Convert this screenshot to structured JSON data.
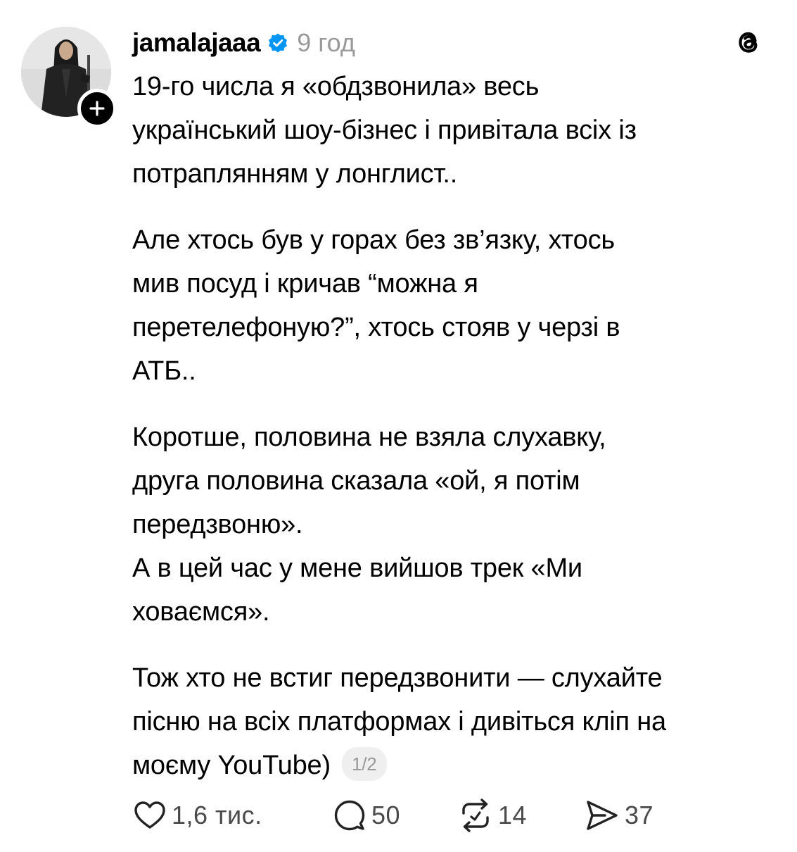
{
  "post": {
    "author": {
      "username": "jamalajaaa",
      "verified": true,
      "avatar_icon": "profile-photo",
      "follow_icon": "plus-icon"
    },
    "time_ago": "9 год",
    "app_icon": "threads-logo-icon",
    "paragraphs": [
      {
        "lines": [
          "19-го числа я «обдзвонила» весь",
          "український шоу-бізнес і привітала всіх із",
          "потраплянням у лонглист.."
        ]
      },
      {
        "lines": [
          "Але хтось був у горах без зв’язку, хтось",
          "мив посуд і кричав “можна я",
          "перетелефоную?”, хтось стояв у черзі в",
          "АТБ.."
        ]
      },
      {
        "lines": [
          "Коротше, половина не взяла слухавку,",
          "друга половина сказала «ой, я потім",
          "передзвоню».",
          "А в цей час у мене вийшов трек «Ми",
          "ховаємся»."
        ]
      },
      {
        "lines": [
          "Тож хто не встиг передзвонити — слухайте",
          "пісню на всіх платформах і дивіться кліп на",
          "моєму YouTube)"
        ]
      }
    ],
    "page_indicator": "1/2",
    "actions": {
      "like": {
        "icon": "heart-icon",
        "count": "1,6 тис."
      },
      "reply": {
        "icon": "comment-icon",
        "count": "50"
      },
      "repost": {
        "icon": "repost-icon",
        "count": "14"
      },
      "share": {
        "icon": "send-icon",
        "count": "37"
      }
    }
  },
  "colors": {
    "text": "#000000",
    "secondary_text": "#999999",
    "counts": "#4a4a4a",
    "verified_badge": "#0095f6",
    "pager_bg": "#efefef"
  }
}
